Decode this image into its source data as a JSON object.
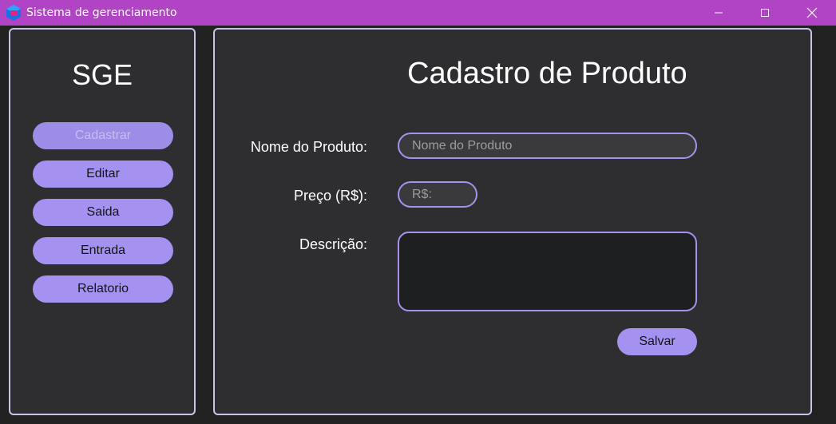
{
  "window": {
    "title": "Sistema de gerenciamento",
    "app_icon": "app-logo-icon",
    "controls": [
      "minimize-icon",
      "maximize-icon",
      "close-icon"
    ],
    "title_bar_color": "#b044c4"
  },
  "sidebar": {
    "title": "SGE",
    "items": [
      {
        "label": "Cadastrar",
        "active": true
      },
      {
        "label": "Editar",
        "active": false
      },
      {
        "label": "Saida",
        "active": false
      },
      {
        "label": "Entrada",
        "active": false
      },
      {
        "label": "Relatorio",
        "active": false
      }
    ]
  },
  "form": {
    "title": "Cadastro de Produto",
    "name_label": "Nome do Produto:",
    "name_placeholder": "Nome do Produto",
    "name_value": "",
    "price_label": "Preço (R$):",
    "price_placeholder": "R$:",
    "price_value": "",
    "description_label": "Descrição:",
    "description_value": "",
    "save_label": "Salvar"
  },
  "colors": {
    "accent": "#a592f0",
    "panel_border": "#c9c3ea",
    "panel_bg": "#2e2d2f"
  }
}
